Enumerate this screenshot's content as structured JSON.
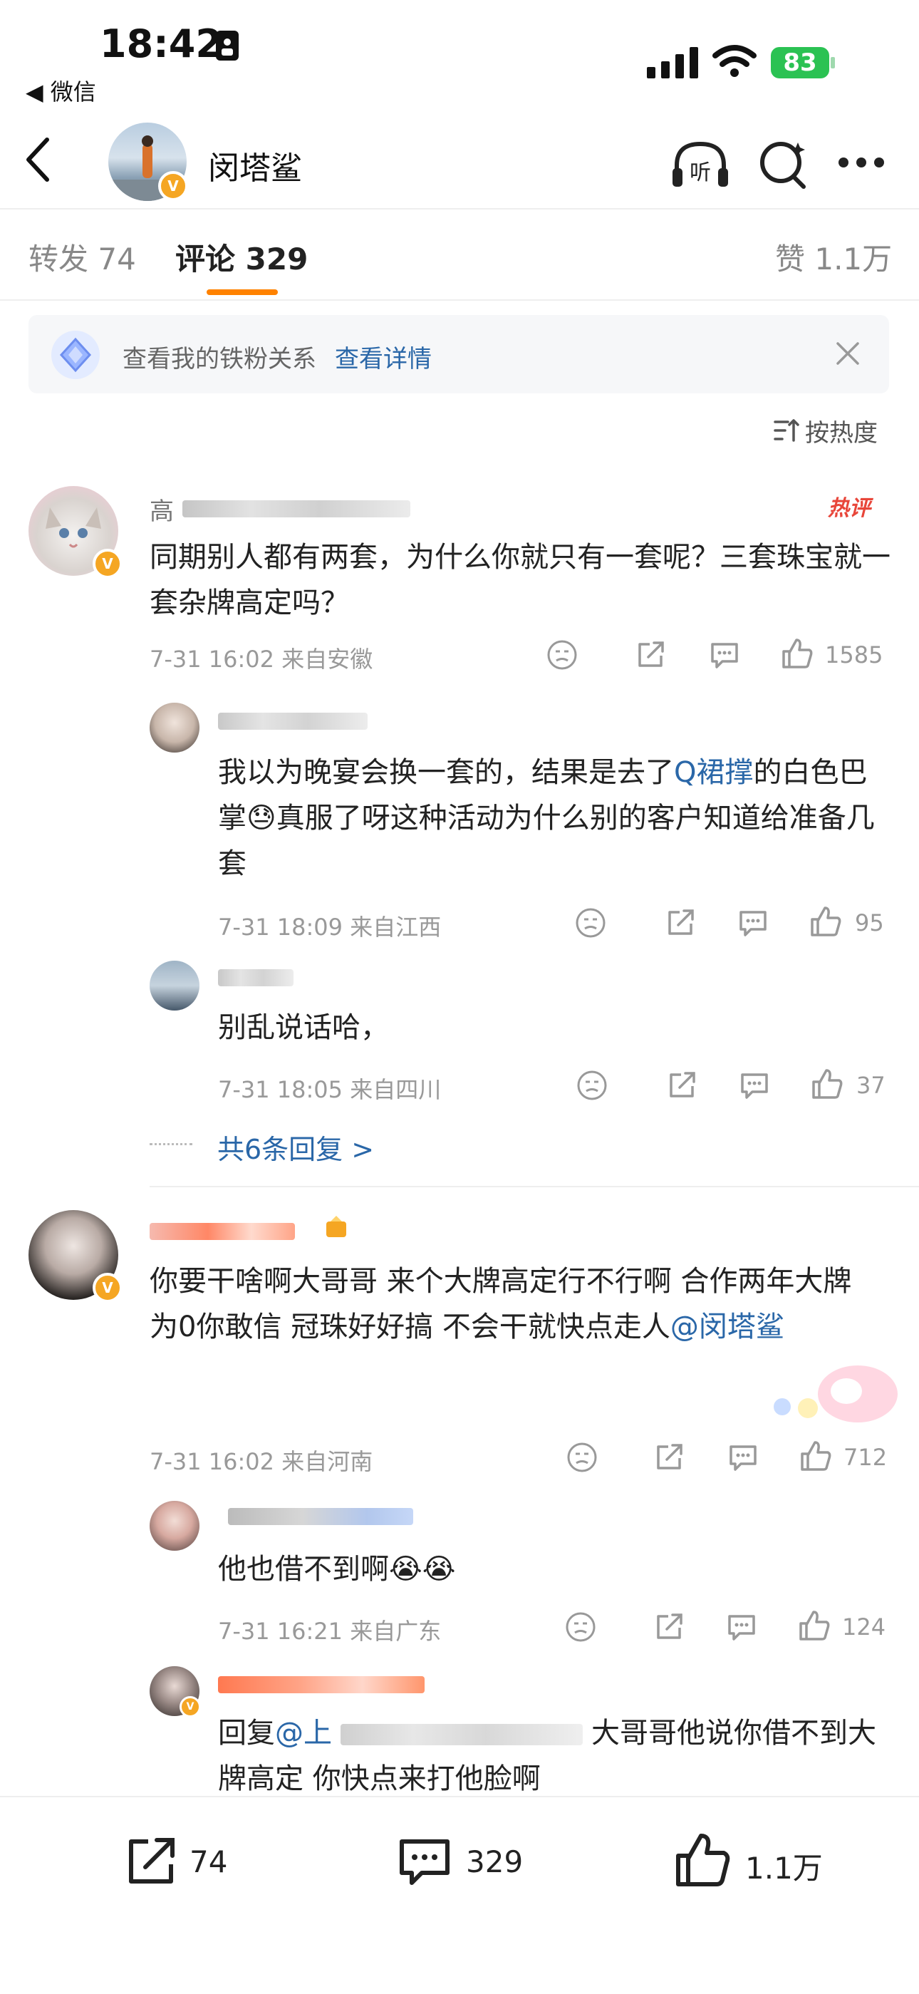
{
  "status_bar": {
    "time": "18:42",
    "back_app": "◀ 微信",
    "battery": "83"
  },
  "header": {
    "title": "闵塔鲨"
  },
  "tabs": {
    "repost": "转发 74",
    "comments": "评论 329",
    "likes": "赞 1.1万"
  },
  "banner": {
    "text": "查看我的铁粉关系",
    "link": "查看详情"
  },
  "sort": {
    "label": "按热度"
  },
  "comment1": {
    "name": "高",
    "badge": "热评",
    "text": "同期别人都有两套，为什么你就只有一套呢？三套珠宝就一套杂牌高定吗？",
    "meta": "7-31 16:02  来自安徽",
    "likes": "1585"
  },
  "reply1a": {
    "text_before": "我以为晚宴会换一套的，结果是去了",
    "link": "Q裙撑",
    "text_after": "的白色巴掌😓真服了呀这种活动为什么别的客户知道给准备几套",
    "meta": "7-31 18:09  来自江西",
    "likes": "95"
  },
  "reply1b": {
    "text": "别乱说话哈，",
    "meta": "7-31 18:05  来自四川",
    "likes": "37"
  },
  "more_replies": "共6条回复 >",
  "comment2": {
    "text": "你要干啥啊大哥哥 来个大牌高定行不行啊 合作两年大牌为0你敢信 冠珠好好搞 不会干就快点走人",
    "mention": "@闵塔鲨",
    "meta": "7-31 16:02  来自河南",
    "likes": "712"
  },
  "reply2a": {
    "text": "他也借不到啊😭😭",
    "meta": "7-31 16:21  来自广东",
    "likes": "124"
  },
  "reply2b": {
    "prefix": "回复",
    "mention": "@上",
    "text": "大哥哥他说你借不到大牌高定 你快点来打他脸啊"
  },
  "bottom_bar": {
    "repost": "74",
    "comment": "329",
    "like": "1.1万"
  }
}
